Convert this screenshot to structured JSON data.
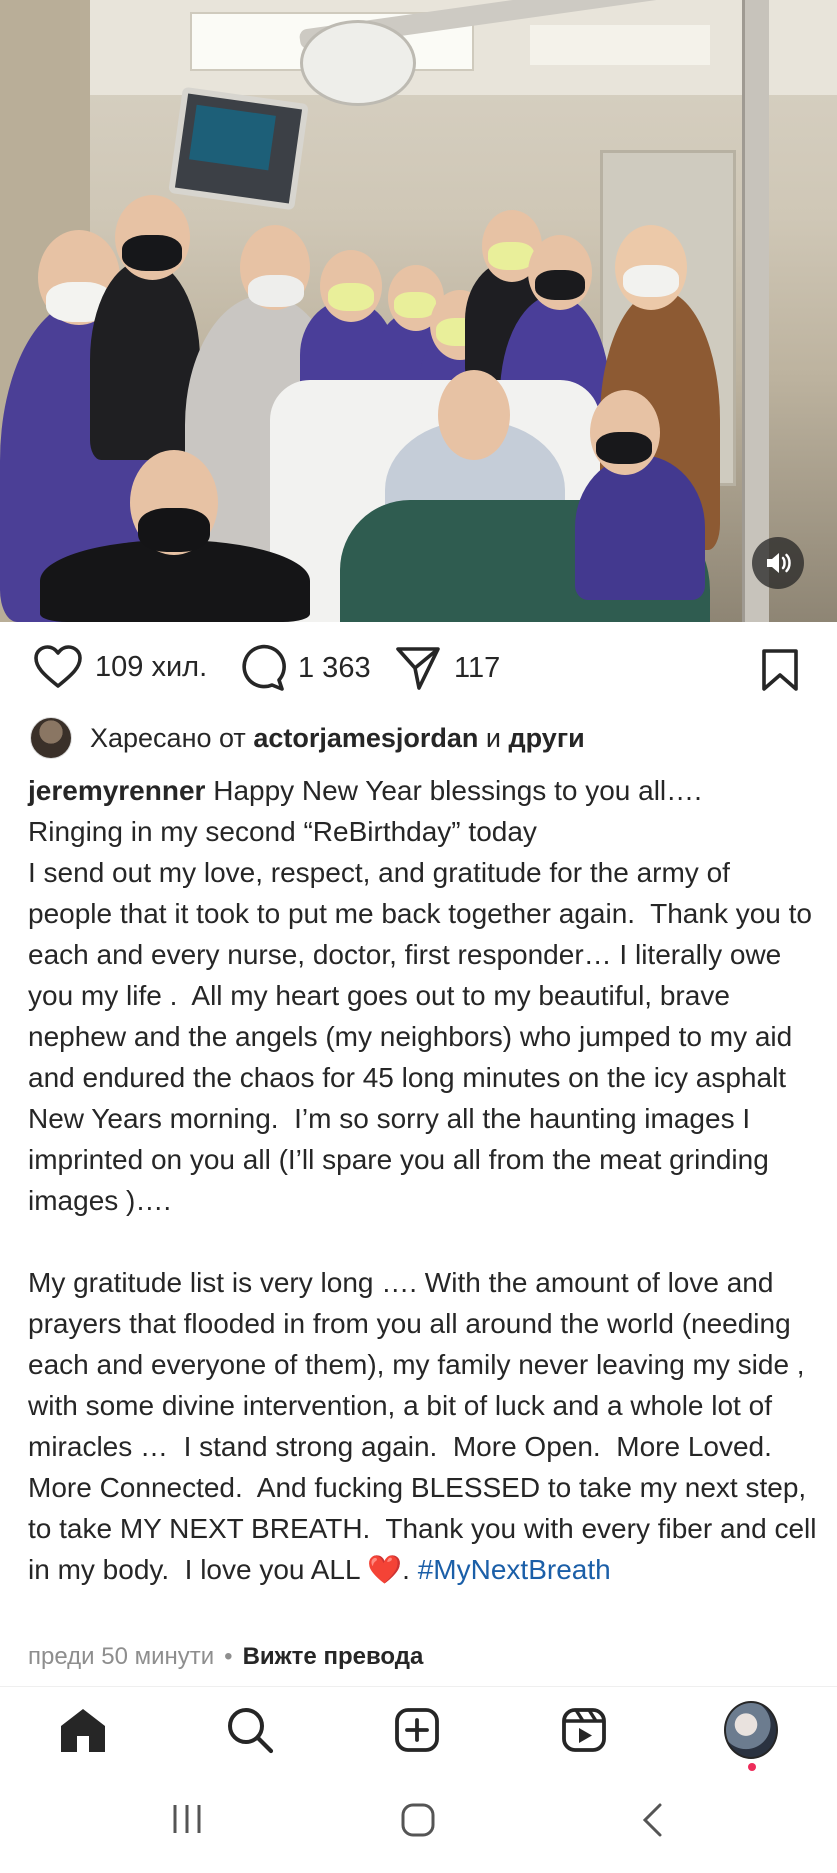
{
  "post": {
    "likes": "109 хил.",
    "comments": "1 363",
    "shares": "117"
  },
  "liked_by": {
    "prefix": "Харесано от ",
    "user": "actorjamesjordan",
    "connector": " и ",
    "others": "други"
  },
  "caption": {
    "username": "jeremyrenner",
    "text_before_heart": " Happy New Year blessings to you all….\nRinging in my second “ReBirthday” today\nI send out my love, respect, and gratitude for the army of people that it took to put me back together again.  Thank you to each and every nurse, doctor, first responder… I literally owe you my life .  All my heart goes out to my beautiful, brave nephew and the angels (my neighbors) who jumped to my aid and endured the chaos for 45 long minutes on the icy asphalt New Years morning.  I’m so sorry all the haunting images I imprinted on you all (I’ll spare you all from the meat grinding images )….\n\nMy gratitude list is very long …. With the amount of love and prayers that flooded in from you all around the world (needing each and everyone of them), my family never leaving my side , with some divine intervention, a bit of luck and a whole lot of miracles …  I stand strong again.  More Open.  More Loved.  More Connected.  And fucking BLESSED to take my next step, to take MY NEXT BREATH.  Thank you with every fiber and cell in my body.  I love you ALL ",
    "heart": "❤️",
    "after_heart": ". ",
    "hashtag": "#MyNextBreath"
  },
  "meta": {
    "time": "преди 50 минути",
    "separator": "•",
    "translate": "Вижте превода"
  },
  "icons": {
    "like": "heart-icon",
    "comment": "comment-icon",
    "share": "send-icon",
    "save": "bookmark-icon",
    "sound": "speaker-icon",
    "home": "home-icon",
    "search": "search-icon",
    "add": "add-post-icon",
    "reels": "reels-icon"
  },
  "colors": {
    "text": "#262626",
    "muted": "#8e8e8e",
    "hashtag": "#1b5fa8",
    "notification": "#ed2c5a"
  }
}
